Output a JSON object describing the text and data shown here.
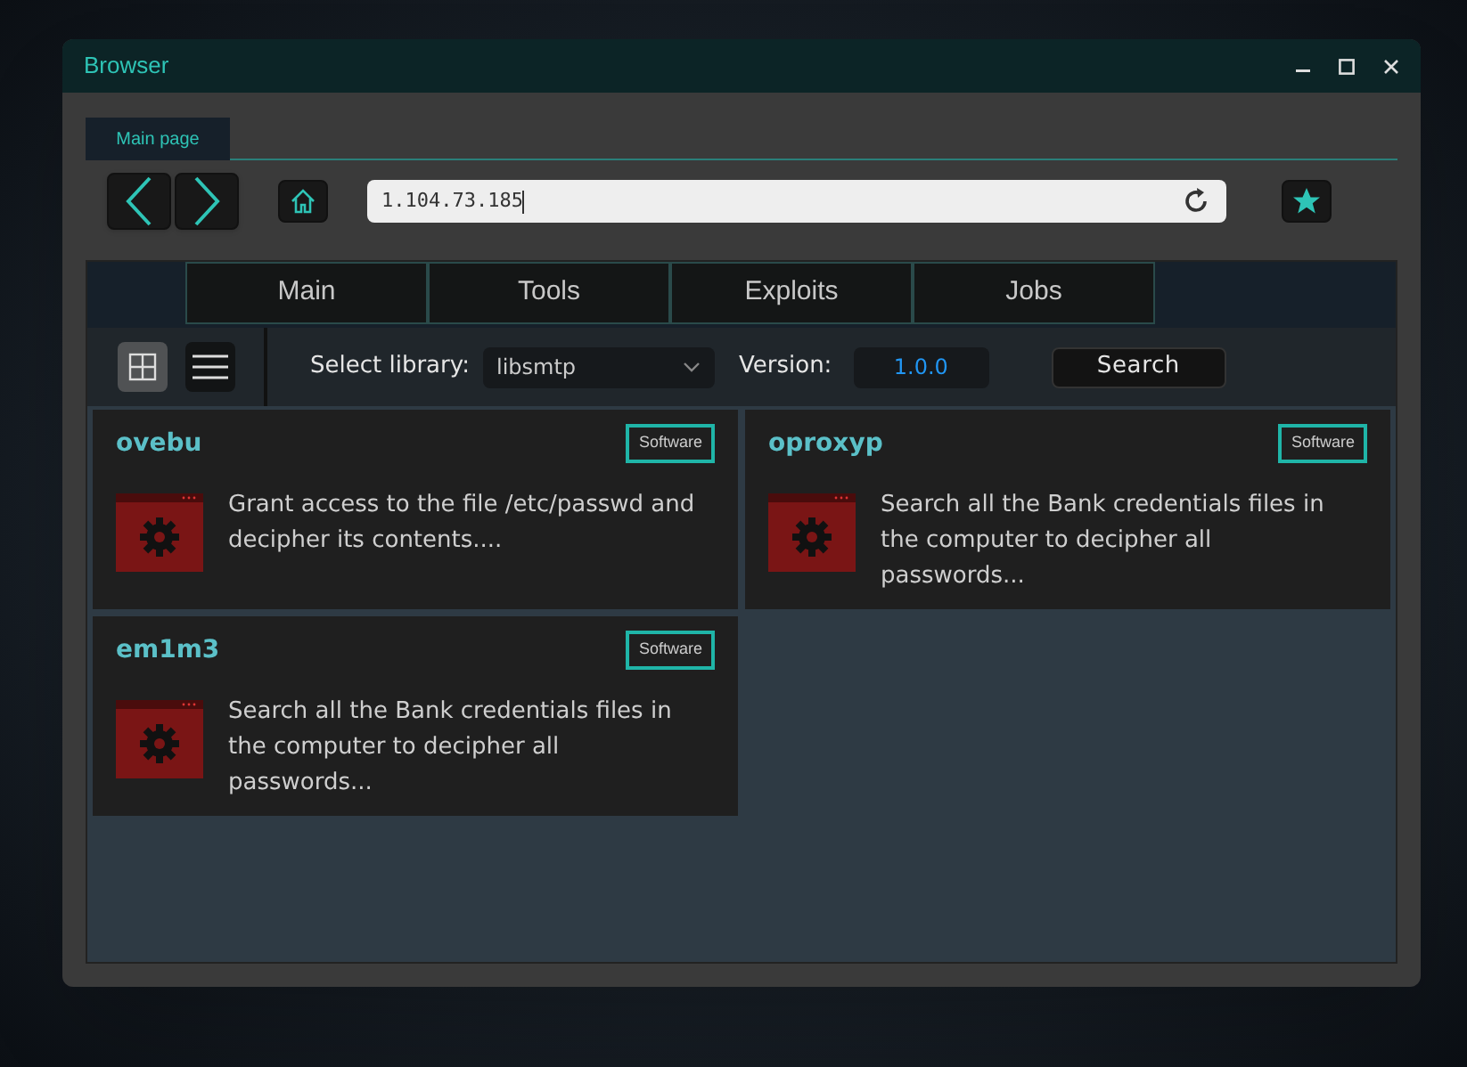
{
  "window": {
    "title": "Browser"
  },
  "browser_tabs": [
    {
      "label": "Main page"
    }
  ],
  "address_bar": {
    "value": "1.104.73.185"
  },
  "nav_tabs": [
    "Main",
    "Tools",
    "Exploits",
    "Jobs"
  ],
  "view_modes": [
    {
      "kind": "grid",
      "selected": true
    },
    {
      "kind": "list",
      "selected": false
    }
  ],
  "filters": {
    "library_label": "Select library:",
    "library_value": "libsmtp",
    "version_label": "Version:",
    "version_value": "1.0.0",
    "search_button": "Search"
  },
  "cards": [
    {
      "name": "ovebu",
      "tag": "Software",
      "description": "Grant access to the file /etc/passwd and decipher its contents...."
    },
    {
      "name": "oproxyp",
      "tag": "Software",
      "description": "Search all the Bank credentials files in the computer to decipher all passwords..."
    },
    {
      "name": "em1m3",
      "tag": "Software",
      "description": "Search all the Bank credentials files in the computer to decipher all passwords..."
    }
  ]
}
